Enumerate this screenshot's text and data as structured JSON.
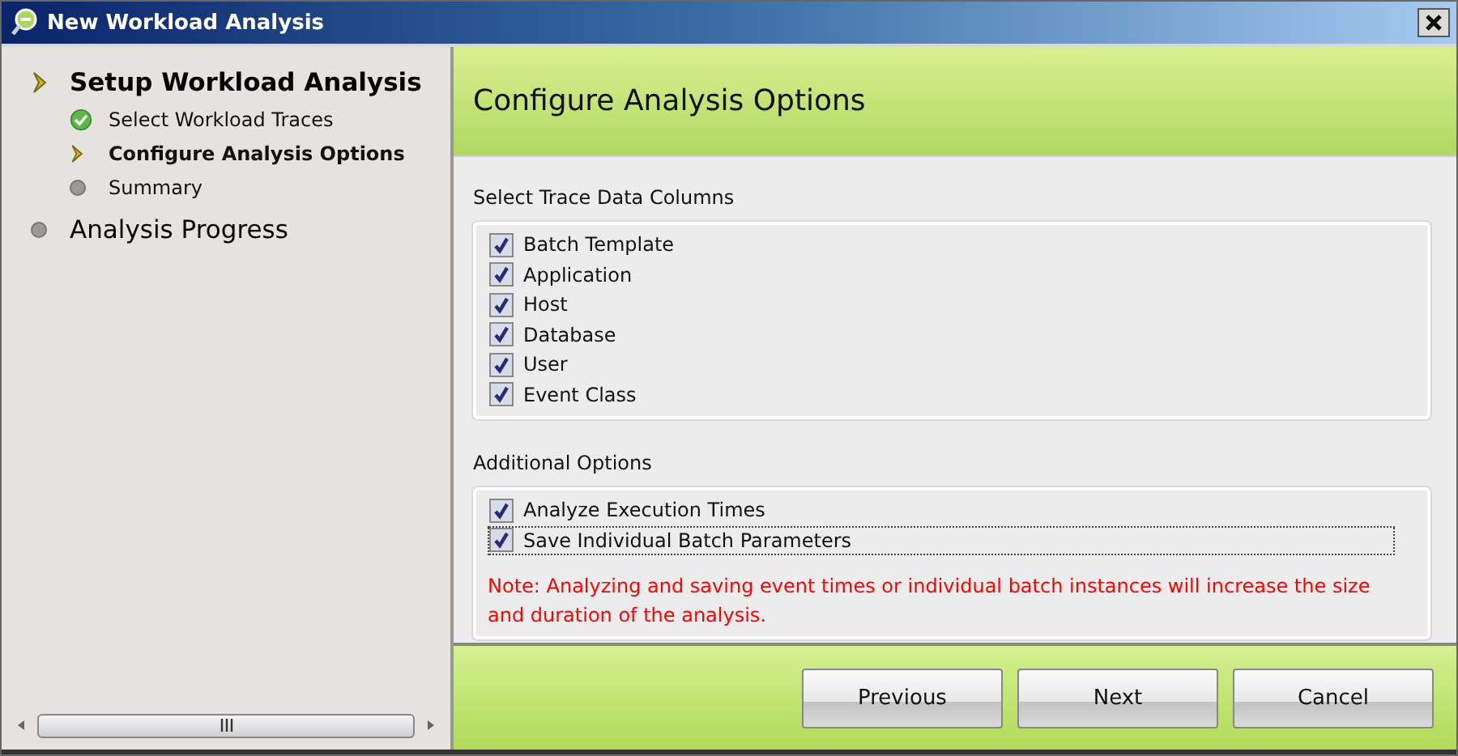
{
  "window": {
    "title": "New Workload Analysis"
  },
  "steps": [
    {
      "label": "Setup Workload Analysis",
      "selected": true,
      "completed": false,
      "children": [
        {
          "label": "Select Workload Traces",
          "selected": false,
          "completed": true
        },
        {
          "label": "Configure Analysis Options",
          "selected": true,
          "completed": false
        },
        {
          "label": "Summary",
          "selected": false,
          "completed": false
        }
      ]
    },
    {
      "label": "Analysis Progress",
      "selected": false,
      "completed": false
    }
  ],
  "page": {
    "title": "Configure Analysis Options"
  },
  "trace_columns": {
    "label": "Select Trace Data Columns",
    "items": [
      {
        "label": "Batch Template",
        "checked": true,
        "focused": false
      },
      {
        "label": "Application",
        "checked": true,
        "focused": false
      },
      {
        "label": "Host",
        "checked": true,
        "focused": false
      },
      {
        "label": "Database",
        "checked": true,
        "focused": false
      },
      {
        "label": "User",
        "checked": true,
        "focused": false
      },
      {
        "label": "Event Class",
        "checked": true,
        "focused": false
      }
    ]
  },
  "additional_options": {
    "label": "Additional Options",
    "items": [
      {
        "label": "Analyze Execution Times",
        "checked": true,
        "focused": false
      },
      {
        "label": "Save Individual Batch Parameters",
        "checked": true,
        "focused": true
      }
    ],
    "note": "Note: Analyzing and saving event times or individual batch instances will increase the size and duration of the analysis."
  },
  "buttons": [
    "Previous",
    "Next",
    "Cancel"
  ]
}
